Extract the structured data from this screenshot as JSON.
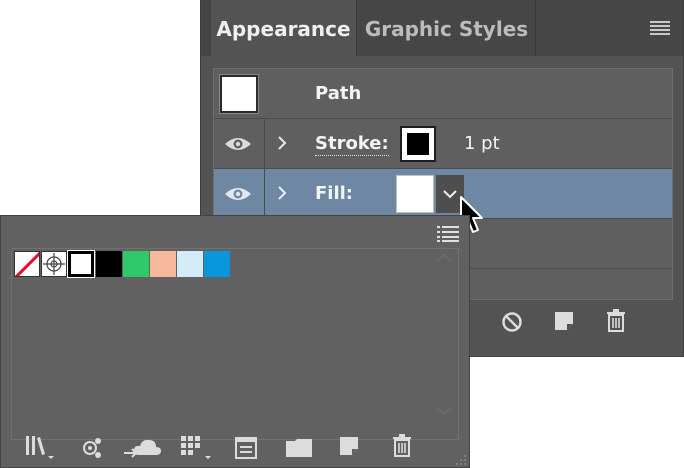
{
  "appearance_panel": {
    "tabs": [
      {
        "label": "Appearance",
        "active": true
      },
      {
        "label": "Graphic Styles",
        "active": false
      }
    ],
    "object_type": "Path",
    "stroke": {
      "label": "Stroke:",
      "weight": "1 pt",
      "color": "#000000"
    },
    "fill": {
      "label": "Fill:",
      "color": "#ffffff",
      "selected": true
    },
    "footer_icons": [
      "clear-appearance-icon",
      "duplicate-item-icon",
      "delete-item-icon"
    ]
  },
  "swatches_popup": {
    "swatches": [
      {
        "name": "none",
        "color": "#ffffff"
      },
      {
        "name": "registration",
        "color": "#ffffff"
      },
      {
        "name": "white",
        "color": "#ffffff"
      },
      {
        "name": "black",
        "color": "#000000"
      },
      {
        "name": "green",
        "color": "#2fc86a"
      },
      {
        "name": "peach",
        "color": "#f5b89a"
      },
      {
        "name": "light-blue",
        "color": "#d4ecf8"
      },
      {
        "name": "blue",
        "color": "#0a96da"
      }
    ],
    "footer_icons": [
      "swatch-libraries-icon",
      "show-swatch-kinds-icon",
      "add-to-library-icon",
      "swatch-options-icon",
      "new-color-group-icon",
      "new-swatch-icon",
      "delete-swatch-icon"
    ]
  }
}
